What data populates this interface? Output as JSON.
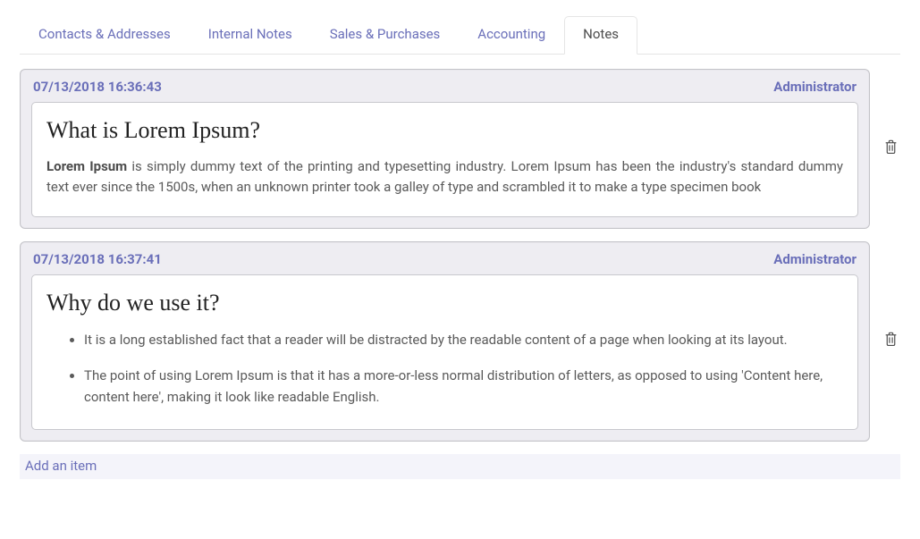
{
  "tabs": [
    {
      "label": "Contacts & Addresses"
    },
    {
      "label": "Internal Notes"
    },
    {
      "label": "Sales & Purchases"
    },
    {
      "label": "Accounting"
    },
    {
      "label": "Notes",
      "active": true
    }
  ],
  "notes": [
    {
      "timestamp": "07/13/2018 16:36:43",
      "author": "Administrator",
      "title": "What is Lorem Ipsum?",
      "bold_lead": "Lorem Ipsum",
      "para_rest": " is simply dummy text of the printing and typesetting industry. Lorem Ipsum has been the industry's standard dummy text ever since the 1500s, when an unknown printer took a galley of type and scrambled it to make a type specimen book"
    },
    {
      "timestamp": "07/13/2018 16:37:41",
      "author": "Administrator",
      "title": "Why do we use it?",
      "bullets": [
        "It is a long established fact that a reader will be distracted by the readable content of a page when looking at its layout.",
        "The point of using Lorem Ipsum is that it has a more-or-less normal distribution of letters, as opposed to using 'Content here, content here', making it look like readable English."
      ]
    }
  ],
  "add_item_label": "Add an item"
}
